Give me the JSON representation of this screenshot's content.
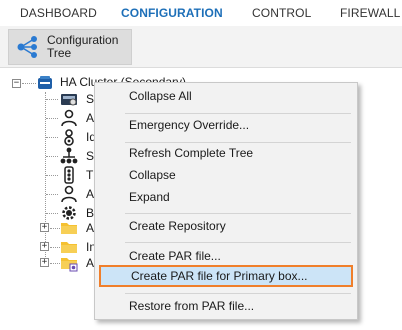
{
  "topnav": {
    "tabs": [
      {
        "label": "DASHBOARD",
        "active": false
      },
      {
        "label": "CONFIGURATION",
        "active": true
      },
      {
        "label": "CONTROL",
        "active": false
      },
      {
        "label": "FIREWALL",
        "active": false
      }
    ]
  },
  "ribbon": {
    "config_tree_button": {
      "label": "Configuration\nTree",
      "icon": "tree-network-icon"
    }
  },
  "tree": {
    "root": {
      "label": "HA Cluster (Secondary)",
      "icon": "server-cluster-icon",
      "expanded": true
    },
    "children": [
      {
        "label": "S",
        "icon": "settings-box-icon"
      },
      {
        "label": "A",
        "icon": "admin-user-icon"
      },
      {
        "label": "Id",
        "icon": "identity-gear-icon"
      },
      {
        "label": "S",
        "icon": "network-hierarchy-icon"
      },
      {
        "label": "T",
        "icon": "traffic-light-icon"
      },
      {
        "label": "A",
        "icon": "user-icon"
      },
      {
        "label": "B",
        "icon": "gear-icon"
      },
      {
        "label": "A",
        "icon": "folder-icon",
        "expandable": true
      },
      {
        "label": "In",
        "icon": "folder-icon",
        "expandable": true
      },
      {
        "label": "A",
        "icon": "folder-settings-icon",
        "expandable": true
      }
    ]
  },
  "context_menu": {
    "items": [
      {
        "label": "Collapse All"
      },
      {
        "separator": true
      },
      {
        "label": "Emergency Override..."
      },
      {
        "separator": true
      },
      {
        "label": "Refresh Complete Tree"
      },
      {
        "label": "Collapse"
      },
      {
        "label": "Expand"
      },
      {
        "separator": true
      },
      {
        "label": "Create Repository"
      },
      {
        "separator": true
      },
      {
        "label": "Create PAR file..."
      },
      {
        "label": "Create PAR file for Primary box...",
        "highlighted": true
      },
      {
        "separator": true
      },
      {
        "label": "Restore from PAR file..."
      }
    ]
  },
  "colors": {
    "active_tab": "#1d6fb8",
    "highlight_bg": "#cce4f7",
    "highlight_border": "#f07f2b",
    "menu_bg": "#f2f2f2",
    "folder": "#f5c131"
  }
}
